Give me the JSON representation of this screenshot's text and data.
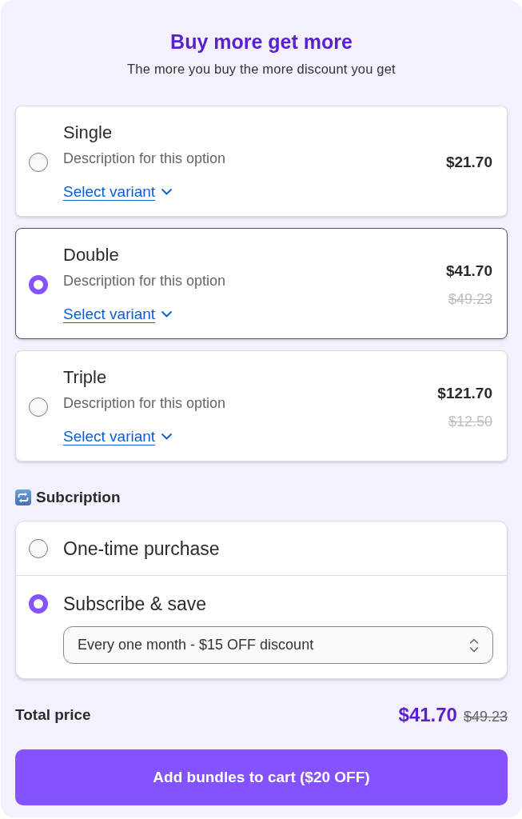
{
  "header": {
    "title": "Buy more get more",
    "subtitle": "The more you buy the more discount you get"
  },
  "bundles": [
    {
      "title": "Single",
      "description": "Description for this option",
      "link": "Select variant",
      "price": "$21.70",
      "selected": false
    },
    {
      "title": "Double",
      "description": "Description for this option",
      "link": "Select variant",
      "price": "$41.70",
      "compare_price": "$49.23",
      "selected": true
    },
    {
      "title": "Triple",
      "description": "Description for this option",
      "link": "Select variant",
      "price": "$121.70",
      "compare_price": "$12.50",
      "selected": false
    }
  ],
  "subscription": {
    "heading": "Subcription",
    "options": [
      {
        "label": "One-time purchase",
        "selected": false
      },
      {
        "label": "Subscribe & save",
        "selected": true,
        "select": {
          "value": "Every one month - $15 OFF discount"
        }
      }
    ]
  },
  "total": {
    "label": "Total price",
    "price": "$41.70",
    "compare_price": "$49.23"
  },
  "button": {
    "label": "Add bundles to cart ($20 OFF)"
  }
}
